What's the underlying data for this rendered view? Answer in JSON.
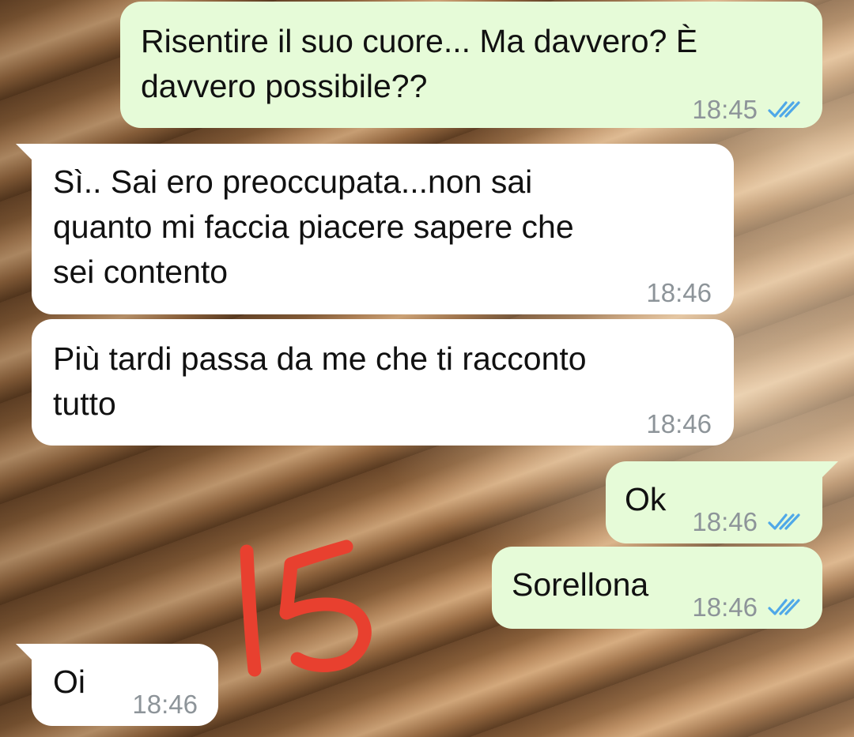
{
  "chat": {
    "messages": [
      {
        "direction": "out",
        "text": "Risentire il suo cuore... Ma davvero? È\ndavvero possibile??",
        "time": "18:45",
        "status": "read"
      },
      {
        "direction": "in",
        "text": "Sì.. Sai ero preoccupata...non sai\nquanto mi faccia piacere sapere che\nsei contento",
        "time": "18:46"
      },
      {
        "direction": "in",
        "text": "Più tardi passa da me che ti racconto\ntutto",
        "time": "18:46"
      },
      {
        "direction": "out",
        "text": "Ok",
        "time": "18:46",
        "status": "read"
      },
      {
        "direction": "out",
        "text": "Sorellona",
        "time": "18:46",
        "status": "read"
      },
      {
        "direction": "in",
        "text": "Oi",
        "time": "18:46"
      }
    ]
  },
  "annotation": {
    "text": "15",
    "color": "#e8402f"
  },
  "colors": {
    "outgoing_bubble": "#e6fbd8",
    "incoming_bubble": "#ffffff",
    "timestamp": "#8d9499",
    "read_ticks": "#4fa8e8"
  },
  "icons": {
    "read_receipt": "double-check-icon"
  }
}
